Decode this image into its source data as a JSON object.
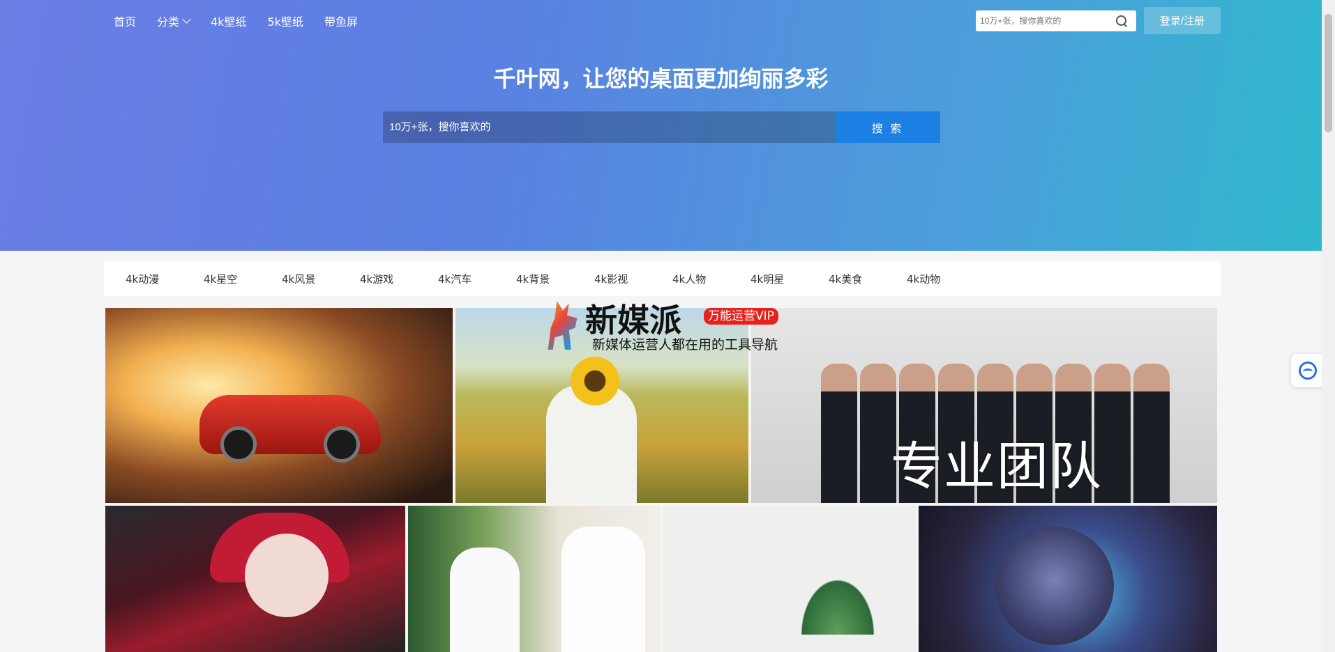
{
  "nav": {
    "items": [
      {
        "label": "首页"
      },
      {
        "label": "分类",
        "has_dropdown": true
      },
      {
        "label": "4k壁纸"
      },
      {
        "label": "5k壁纸"
      },
      {
        "label": "带鱼屏"
      }
    ]
  },
  "top_search": {
    "placeholder": "10万+张，搜你喜欢的",
    "icon": "search-icon"
  },
  "login_label": "登录/注册",
  "hero": {
    "title": "千叶网，让您的桌面更加绚丽多彩",
    "search_placeholder": "10万+张，搜你喜欢的",
    "search_button": "搜 索"
  },
  "categories": [
    "4k动漫",
    "4k星空",
    "4k风景",
    "4k游戏",
    "4k汽车",
    "4k背景",
    "4k影视",
    "4k人物",
    "4k明星",
    "4k美食",
    "4k动物"
  ],
  "ad_overlay": {
    "main": "新媒派",
    "badge": "万能运营VIP",
    "sub": "新媒体运营人都在用的工具导航"
  },
  "tile_texts": {
    "team": "专业团队"
  },
  "colors": {
    "hero_start": "#6a7ee6",
    "hero_end": "#2fb8cc",
    "search_button": "#1b7fe3",
    "ad_badge": "#e8211b"
  }
}
